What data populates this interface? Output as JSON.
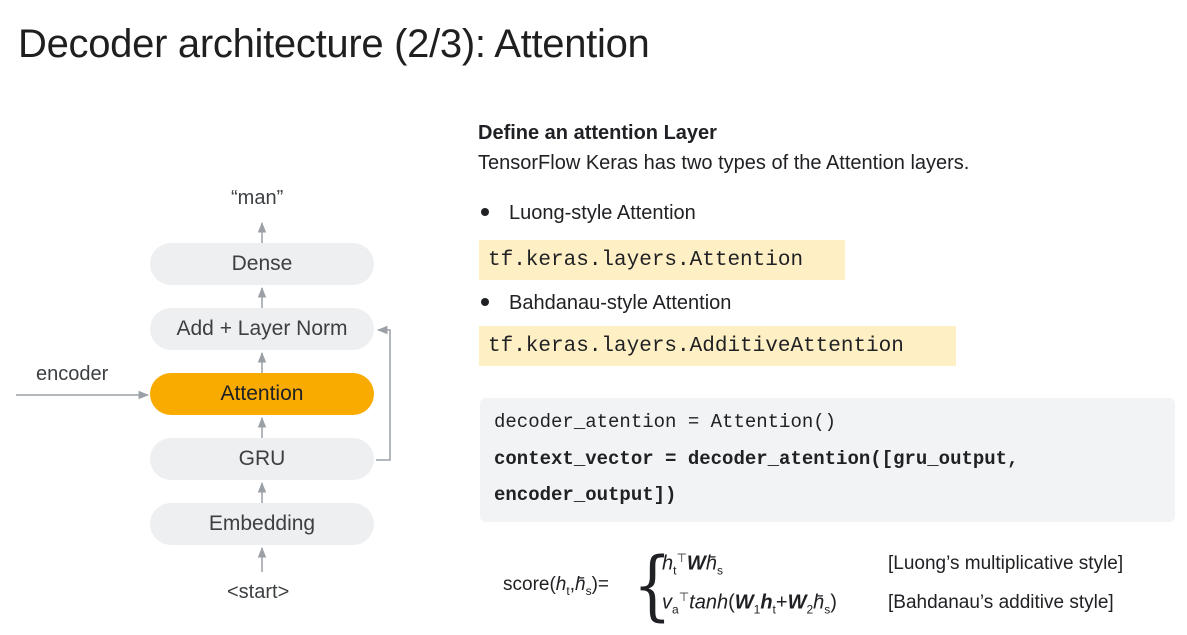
{
  "slide": {
    "title": "Decoder architecture (2/3): Attention"
  },
  "diagram": {
    "output_label": "“man”",
    "input_label": "<start>",
    "side_label": "encoder",
    "blocks": {
      "dense": "Dense",
      "add_norm": "Add + Layer Norm",
      "attention": "Attention",
      "gru": "GRU",
      "embedding": "Embedding"
    },
    "colors": {
      "accent": "#f9ab00",
      "block": "#eeeff1",
      "arrow": "#9aa0a6"
    }
  },
  "panel": {
    "heading": "Define an attention Layer",
    "subheading": "TensorFlow Keras has two types of the Attention layers.",
    "bullets": [
      {
        "text": "Luong-style Attention",
        "code": "tf.keras.layers.Attention"
      },
      {
        "text": "Bahdanau-style Attention",
        "code": "tf.keras.layers.AdditiveAttention"
      }
    ],
    "code_lines": [
      "decoder_atention = Attention()",
      "context_vector = decoder_atention([gru_output,",
      "encoder_output])"
    ],
    "highlight_color": "#fef0c4",
    "code_bg": "#f1f3f4"
  },
  "formula": {
    "notes": [
      "[Luong’s multiplicative style]",
      "[Bahdanau’s additive style]"
    ]
  }
}
